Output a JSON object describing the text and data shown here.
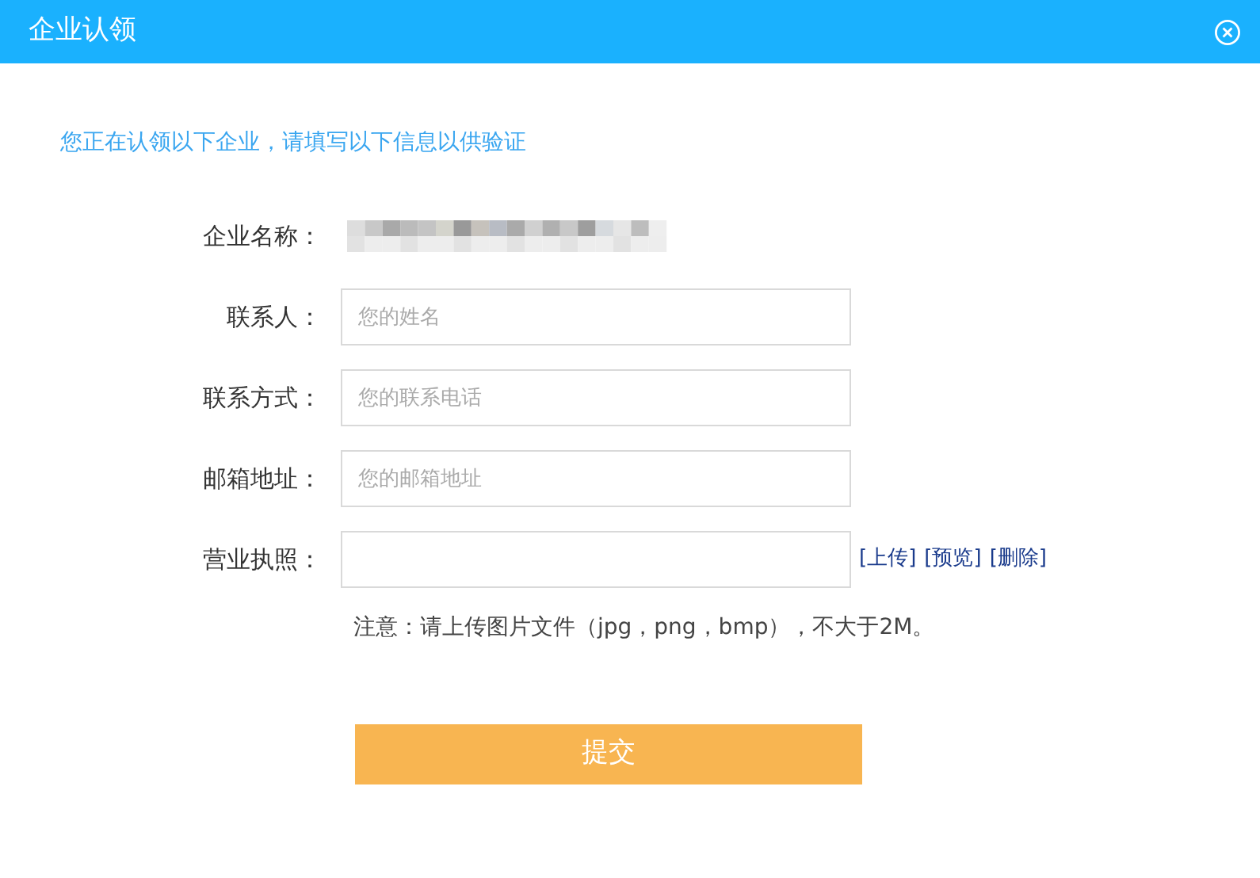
{
  "window": {
    "title": "企业认领"
  },
  "intro": "您正在认领以下企业，请填写以下信息以供验证",
  "fields": [
    {
      "kind": "redacted",
      "label": "企业名称："
    },
    {
      "kind": "input",
      "label": "联系人：",
      "placeholder": "您的姓名"
    },
    {
      "kind": "input",
      "label": "联系方式：",
      "placeholder": "您的联系电话"
    },
    {
      "kind": "input",
      "label": "邮箱地址：",
      "placeholder": "您的邮箱地址"
    },
    {
      "kind": "upload",
      "label": "营业执照：",
      "links": [
        "[上传]",
        "[预览]",
        "[删除]"
      ]
    }
  ],
  "note": "注意：请上传图片文件（jpg，png，bmp），不大于2M。",
  "submit": "提交"
}
